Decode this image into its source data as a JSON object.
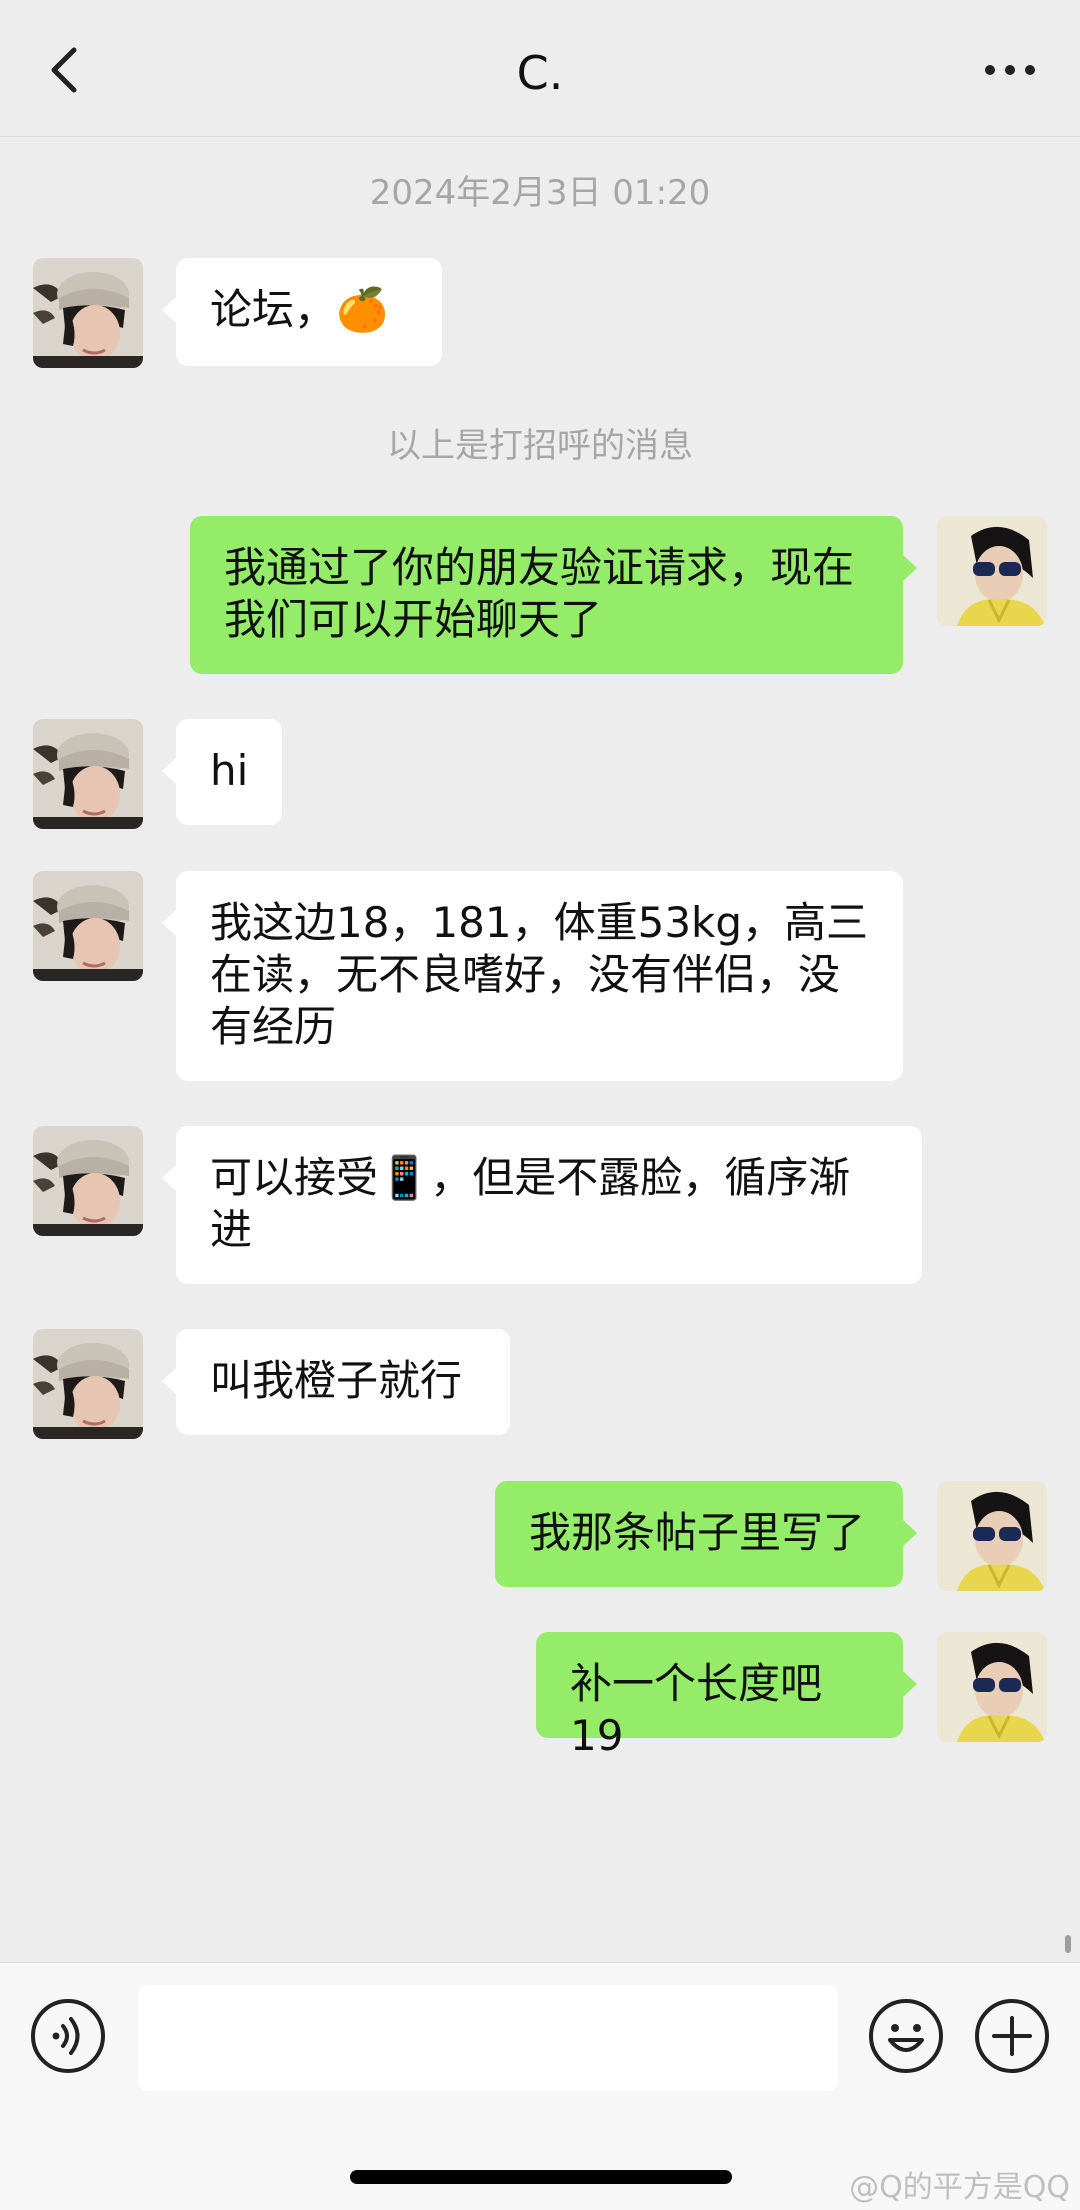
{
  "header": {
    "back_icon": "chevron-left-icon",
    "title": "C.",
    "more_icon": "more-dots-icon"
  },
  "timestamp": "2024年2月3日 01:20",
  "system_message": "以上是打招呼的消息",
  "messages": [
    {
      "from": "contact",
      "text": "论坛，🍊"
    },
    {
      "from": "me",
      "text": "我通过了你的朋友验证请求，现在我们可以开始聊天了"
    },
    {
      "from": "contact",
      "text": "hi"
    },
    {
      "from": "contact",
      "text": "我这边18，181，体重53kg，高三在读，无不良嗜好，没有伴侣，没有经历"
    },
    {
      "from": "contact",
      "text": "可以接受📱，但是不露脸，循序渐进"
    },
    {
      "from": "contact",
      "text": "叫我橙子就行"
    },
    {
      "from": "me",
      "text": "我那条帖子里写了"
    },
    {
      "from": "me",
      "text": "补一个长度吧19"
    }
  ],
  "input_bar": {
    "voice_icon": "voice-icon",
    "input_value": "",
    "emoji_icon": "emoji-icon",
    "plus_icon": "plus-icon"
  },
  "watermark": "@Q的平方是QQ",
  "colors": {
    "background": "#ededed",
    "outgoing_bubble": "#95ec69",
    "incoming_bubble": "#ffffff"
  }
}
